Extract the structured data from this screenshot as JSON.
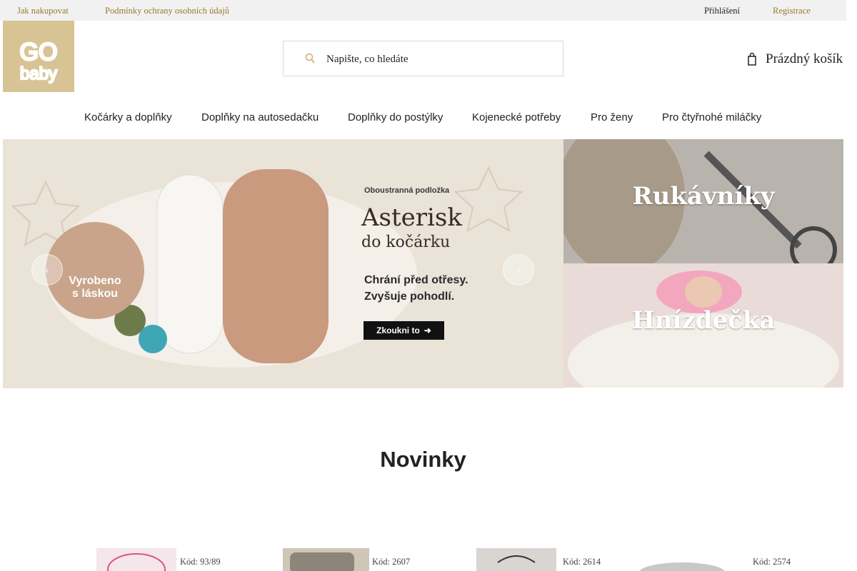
{
  "topbar": {
    "links": [
      "Jak nakupovat",
      "Podmínky ochrany osobních údajů"
    ],
    "login": "Přihlášení",
    "register": "Registrace"
  },
  "logo": {
    "line1": "GO",
    "line2": "baby"
  },
  "search": {
    "placeholder": "Napište, co hledáte",
    "icon": "search-icon"
  },
  "cart": {
    "label": "Prázdný košík",
    "icon": "cart-icon"
  },
  "nav": {
    "items": [
      "Kočárky a doplňky",
      "Doplňky na autosedačku",
      "Doplňky do postýlky",
      "Kojenecké potřeby",
      "Pro ženy",
      "Pro čtyřnohé miláčky"
    ]
  },
  "hero": {
    "eyebrow": "Oboustranná podložka",
    "title1": "Asterisk",
    "title2": "do kočárku",
    "line1": "Chrání před otřesy.",
    "line2": "Zvyšuje pohodlí.",
    "cta": "Zkoukni to",
    "badge_line1": "Vyrobeno",
    "badge_line2": "s láskou",
    "prev_icon": "chevron-left-icon",
    "next_icon": "chevron-right-icon"
  },
  "side_banners": [
    "Rukávníky",
    "Hnízdečka"
  ],
  "section": {
    "title": "Novinky"
  },
  "products": [
    {
      "code": "Kód: 93/89"
    },
    {
      "code": "Kód: 2607"
    },
    {
      "code": "Kód: 2614"
    },
    {
      "code": "Kód: 2574"
    }
  ],
  "colors": {
    "topbar_bg": "#f1f1f1",
    "accent_gold": "#9b7a2d",
    "logo_bg": "#d8c394"
  }
}
